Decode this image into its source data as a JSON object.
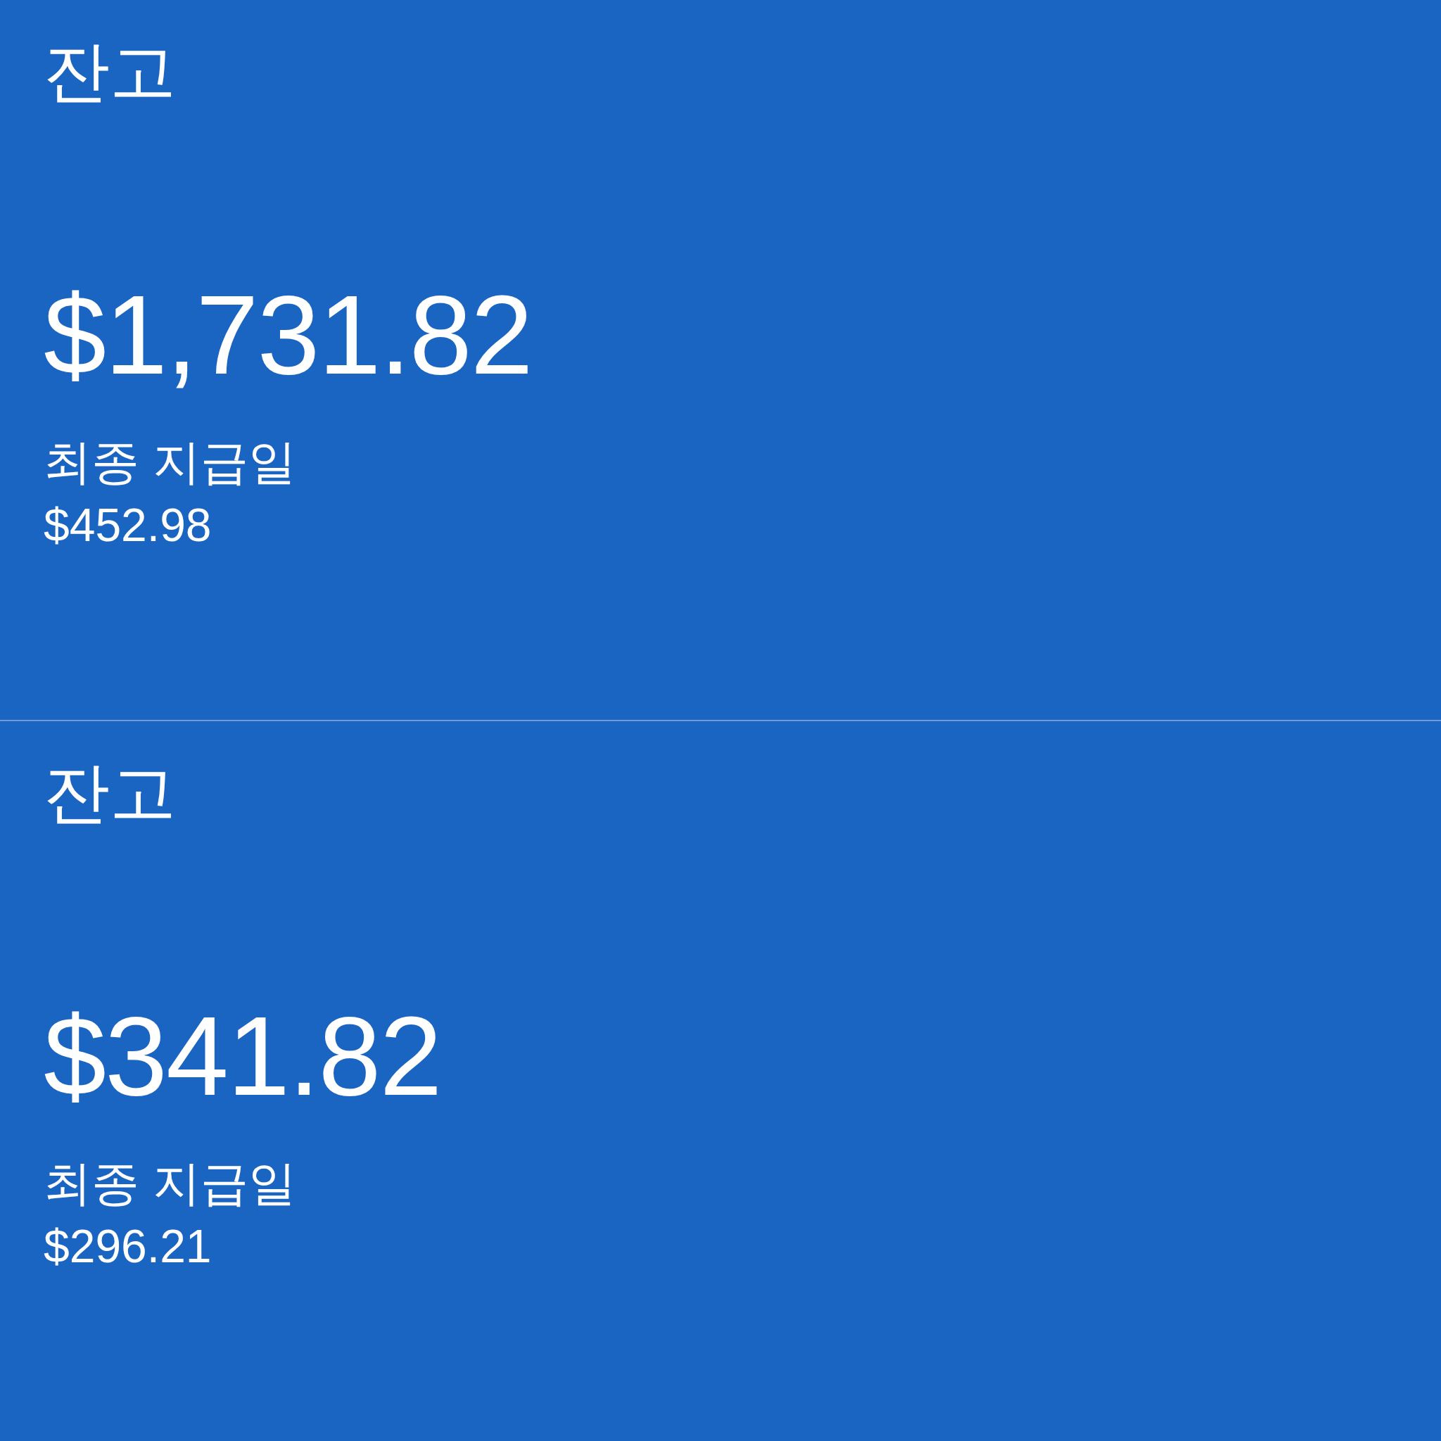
{
  "cards": [
    {
      "title": "잔고",
      "balance": "$1,731.82",
      "label": "최종 지급일",
      "amount": "$452.98"
    },
    {
      "title": "잔고",
      "balance": "$341.82",
      "label": "최종 지급일",
      "amount": "$296.21"
    }
  ]
}
